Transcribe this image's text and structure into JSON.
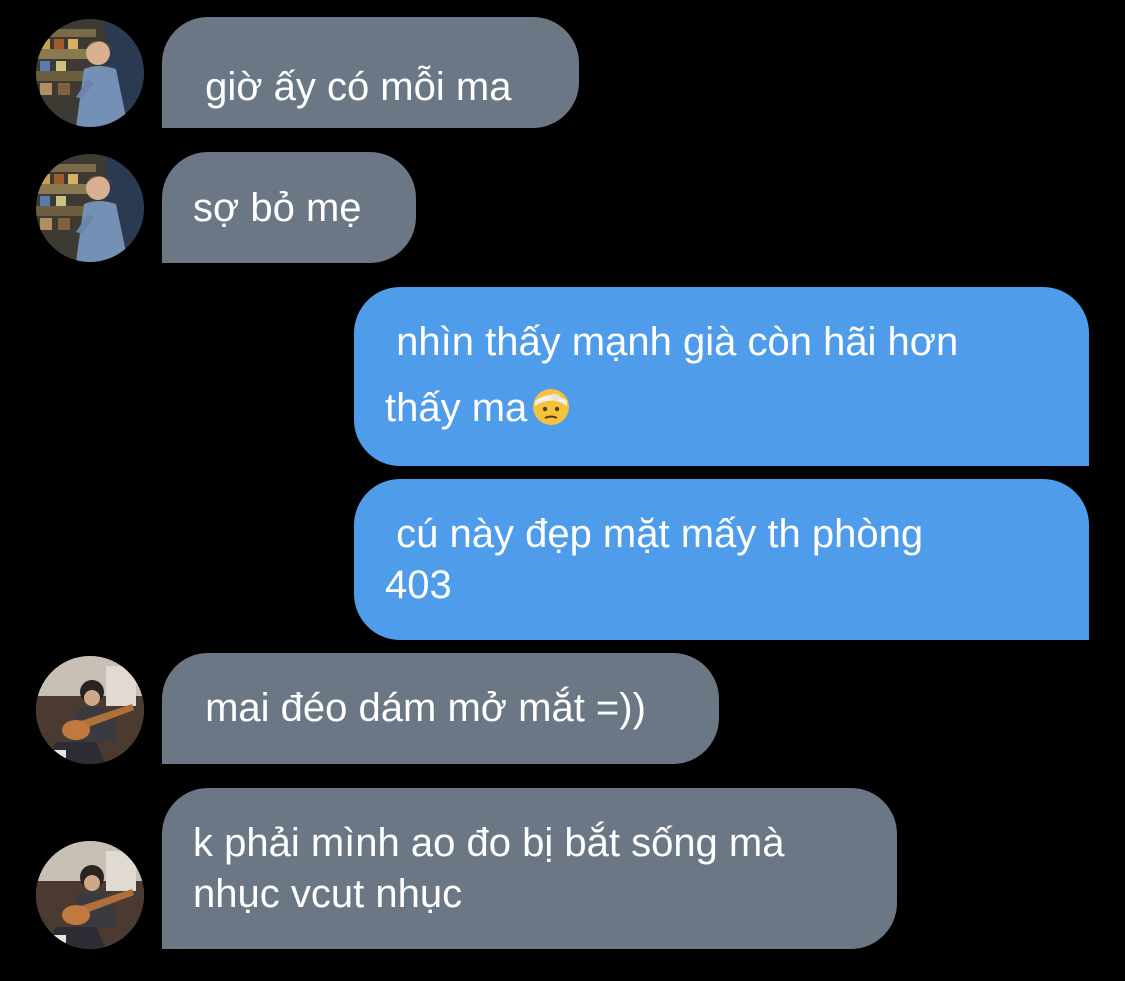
{
  "conversation": {
    "messages": [
      {
        "sender": "contact_a",
        "lines": [
          " giờ ấy có mỗi ma"
        ]
      },
      {
        "sender": "contact_a",
        "lines": [
          "sợ bỏ mẹ"
        ]
      },
      {
        "sender": "me",
        "lines": [
          " nhìn thấy mạnh già còn hãi hơn",
          "thấy ma"
        ],
        "emoji": "face-with-head-bandage-emoji"
      },
      {
        "sender": "me",
        "lines": [
          " cú này đẹp mặt mấy th phòng",
          "403"
        ]
      },
      {
        "sender": "contact_b",
        "lines": [
          " mai đéo dám mở mắt =))"
        ]
      },
      {
        "sender": "contact_b",
        "lines": [
          "k phải mình ao đo bị bắt sống mà",
          "nhục vcut nhục"
        ]
      }
    ]
  },
  "colors": {
    "background": "#000000",
    "received_bubble": "#6b7785",
    "sent_bubble": "#4e9cea",
    "text": "#ffffff"
  },
  "icons": {
    "avatar_a": "avatar-person-in-store-photo",
    "avatar_b": "avatar-person-with-guitar-photo",
    "emoji": "face-with-head-bandage-emoji"
  }
}
